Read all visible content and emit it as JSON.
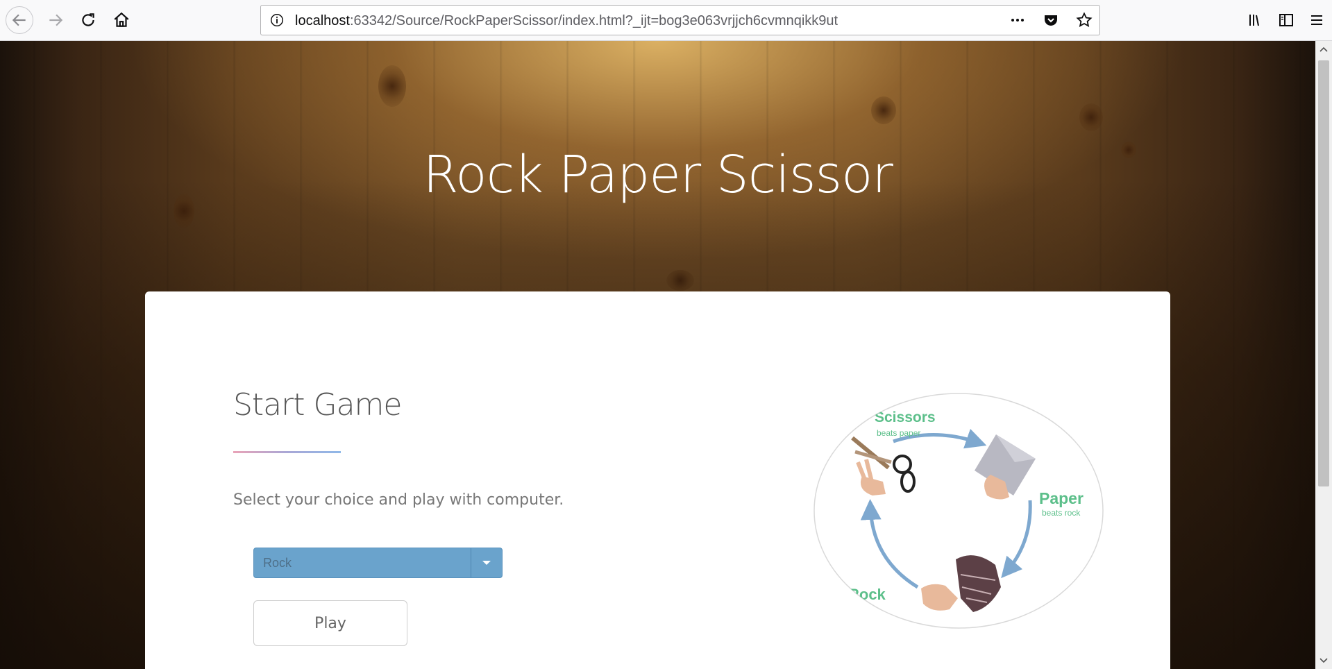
{
  "browser": {
    "url_host": "localhost",
    "url_rest": ":63342/Source/RockPaperScissor/index.html?_ijt=bog3e063vrjjch6cvmnqikk9ut",
    "icons": [
      "back-arrow-icon",
      "forward-arrow-icon",
      "reload-icon",
      "home-icon",
      "info-icon",
      "more-icon",
      "pocket-icon",
      "bookmark-star-icon",
      "library-icon",
      "sidebar-icon",
      "menu-icon"
    ]
  },
  "page": {
    "hero_title": "Rock Paper Scissor",
    "card": {
      "title": "Start Game",
      "description": "Select your choice and play with computer.",
      "select_value": "Rock",
      "play_label": "Play"
    },
    "diagram": {
      "scissors_label": "Scissors",
      "scissors_sub": "beats paper",
      "paper_label": "Paper",
      "paper_sub": "beats rock",
      "rock_label": "Rock"
    }
  },
  "colors": {
    "accent": "#6aa3cc",
    "diagram_text": "#5cbf8a",
    "arrow": "#7ea8cf"
  }
}
